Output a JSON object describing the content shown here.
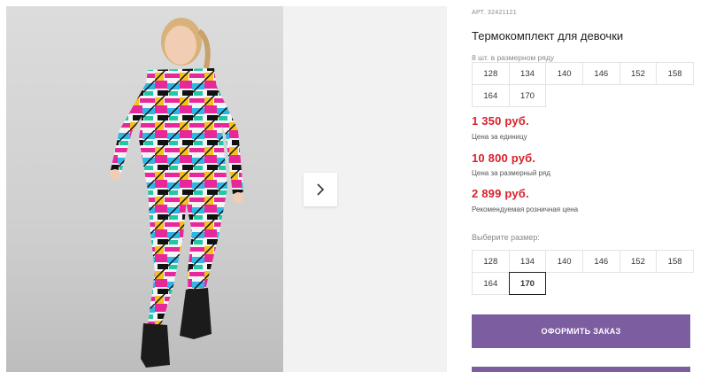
{
  "product": {
    "sku": "АРТ. 32421121",
    "title": "Термокомплект для девочки",
    "pack_label": "8 шт. в размерном ряду",
    "pack_sizes": [
      "128",
      "134",
      "140",
      "146",
      "152",
      "158",
      "164",
      "170"
    ],
    "prices": [
      {
        "value": "1 350 руб.",
        "note": "Цена за единицу"
      },
      {
        "value": "10 800 руб.",
        "note": "Цена за размерный ряд"
      },
      {
        "value": "2 899 руб.",
        "note": "Рекомендуемая розничная цена"
      }
    ],
    "choose_size_label": "Выберите размер:",
    "sizes": [
      "128",
      "134",
      "140",
      "146",
      "152",
      "158",
      "164",
      "170"
    ],
    "selected_size": "170",
    "order_button": "ОФОРМИТЬ ЗАКАЗ"
  },
  "icons": {
    "next": "chevron-right-icon"
  },
  "colors": {
    "price": "#d9202a",
    "order_button": "#7b5da0"
  }
}
